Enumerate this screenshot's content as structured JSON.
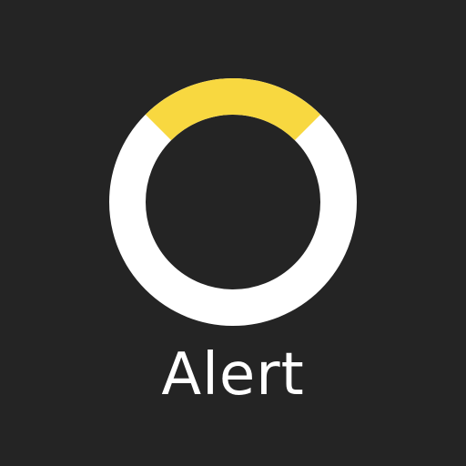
{
  "app": {
    "label": "Alert"
  },
  "icon": {
    "name": "status-ring-icon",
    "arc_fraction": 0.25
  },
  "colors": {
    "background": "#242424",
    "ring": "#ffffff",
    "ring_accent": "#f8d840",
    "text": "#ffffff"
  }
}
